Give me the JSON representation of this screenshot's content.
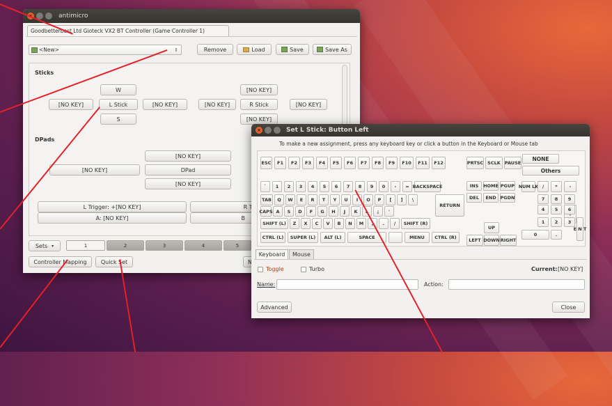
{
  "main_window": {
    "title": "antimicro",
    "tab_label": "Goodbetterbest Ltd Gioteck VX2 BT Controller (Game Controller 1)",
    "profile_select": "<New>",
    "buttons": {
      "remove": "Remove",
      "load": "Load",
      "save": "Save",
      "save_as": "Save As"
    },
    "sticks": {
      "heading": "Sticks",
      "left_up": "W",
      "left_left": "[NO KEY]",
      "left_center": "L Stick",
      "left_right": "[NO KEY]",
      "left_down": "S",
      "right_up": "[NO KEY]",
      "right_left": "[NO KEY]",
      "right_center": "R Stick",
      "right_right": "[NO KEY]",
      "right_down": "[NO KEY]"
    },
    "dpads": {
      "heading": "DPads",
      "up": "[NO KEY]",
      "left": "[NO KEY]",
      "center": "DPad",
      "down": "[NO KEY]"
    },
    "triggers": {
      "l_trigger": "L Trigger: +[NO KEY]",
      "r_trigger": "R Trig",
      "a_button": "A: [NO KEY]",
      "b_button": "B"
    },
    "sets": {
      "label": "Sets",
      "tabs": [
        "1",
        "2",
        "3",
        "4",
        "5"
      ]
    },
    "bottom": {
      "controller_mapping": "Controller Mapping",
      "quick_set": "Quick Set",
      "hidden_right": "N"
    }
  },
  "dialog": {
    "title": "Set L Stick: Button Left",
    "instruction": "To make a new assignment, press any keyboard key or click a button in the Keyboard or Mouse tab",
    "row1": [
      "ESC",
      "F1",
      "F2",
      "F3",
      "F4",
      "F5",
      "F6",
      "F7",
      "F8",
      "F9",
      "F10",
      "F11",
      "F12"
    ],
    "row1_right": [
      "PRTSC",
      "SCLK",
      "PAUSE"
    ],
    "none_label": "NONE",
    "others_label": "Others",
    "row2": [
      "`",
      "1",
      "2",
      "3",
      "4",
      "5",
      "6",
      "7",
      "8",
      "9",
      "0",
      "-",
      "=",
      "BACKSPACE"
    ],
    "row2_nav": [
      "INS",
      "HOME",
      "PGUP"
    ],
    "row3": [
      "TAB",
      "Q",
      "W",
      "E",
      "R",
      "T",
      "Y",
      "U",
      "I",
      "O",
      "P",
      "[",
      "]",
      "\\"
    ],
    "row3_nav": [
      "DEL",
      "END",
      "PGDN"
    ],
    "row4": [
      "CAPS",
      "A",
      "S",
      "D",
      "F",
      "G",
      "H",
      "J",
      "K",
      "L",
      ";",
      "'"
    ],
    "return_label": "RETURN",
    "row5": [
      "SHIFT (L)",
      "Z",
      "X",
      "C",
      "V",
      "B",
      "N",
      "M",
      ",",
      ".",
      "/",
      "SHIFT (R)"
    ],
    "row6": [
      "CTRL (L)",
      "SUPER (L)",
      "ALT (L)",
      "SPACE",
      "",
      "MENU",
      "CTRL (R)"
    ],
    "arrows": {
      "up": "UP",
      "left": "LEFT",
      "down": "DOWN",
      "right": "RIGHT"
    },
    "numpad": {
      "numlk": "NUM LK",
      "slash": "/",
      "star": "*",
      "minus": "-",
      "n7": "7",
      "n8": "8",
      "n9": "9",
      "plus": "+",
      "n4": "4",
      "n5": "5",
      "n6": "6",
      "n1": "1",
      "n2": "2",
      "n3": "3",
      "enter": "E N T",
      "n0": "0",
      "dot": "."
    },
    "tabs": [
      "Keyboard",
      "Mouse"
    ],
    "toggle_label": "Toggle",
    "turbo_label": "Turbo",
    "current_label": "Current:",
    "current_value": "[NO KEY]",
    "name_label": "Name:",
    "action_label": "Action:",
    "advanced_label": "Advanced",
    "close_label": "Close"
  },
  "colors": {
    "annotation": "#e42127",
    "titlebar": "#3c3b37",
    "close_dot": "#e3622f"
  }
}
